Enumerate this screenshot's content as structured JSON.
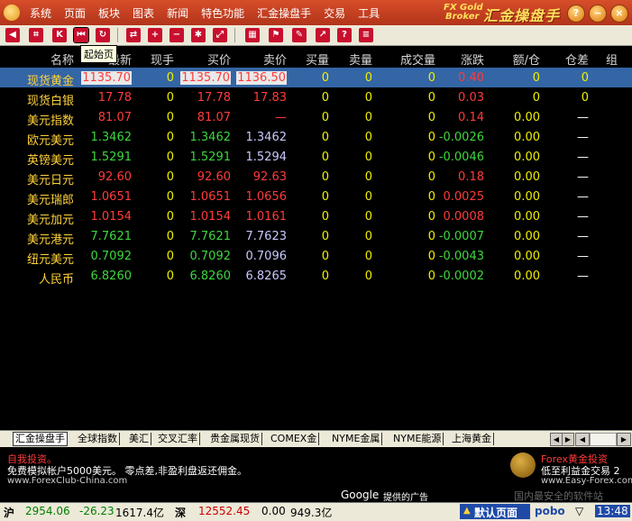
{
  "menu": [
    "系统",
    "页面",
    "板块",
    "图表",
    "新闻",
    "特色功能",
    "汇金操盘手",
    "交易",
    "工具"
  ],
  "brand": {
    "line1": "FX Gold",
    "line2": "Broker",
    "name": "汇金操盘手"
  },
  "window": {
    "help": "?",
    "min": "−",
    "max": "□",
    "close": "×"
  },
  "toolbar": {
    "tooltip": "起始页"
  },
  "columns": [
    "名称",
    "最新",
    "现手",
    "买价",
    "卖价",
    "买量",
    "卖量",
    "成交量",
    "涨跌",
    "额/仓",
    "仓差",
    "组"
  ],
  "rows": [
    {
      "name": "现货黄金",
      "last": "1135.70",
      "hand": "0",
      "bid": "1135.70",
      "ask": "1136.50",
      "bidv": "0",
      "askv": "0",
      "vol": "0",
      "chg": "0.40",
      "amt": "0",
      "diff": "0"
    },
    {
      "name": "现货白银",
      "last": "17.78",
      "hand": "0",
      "bid": "17.78",
      "ask": "17.83",
      "bidv": "0",
      "askv": "0",
      "vol": "0",
      "chg": "0.03",
      "amt": "0",
      "diff": "0"
    },
    {
      "name": "美元指数",
      "last": "81.07",
      "hand": "0",
      "bid": "81.07",
      "ask": "—",
      "bidv": "0",
      "askv": "0",
      "vol": "0",
      "chg": "0.14",
      "amt": "0.00",
      "diff": "—"
    },
    {
      "name": "欧元美元",
      "last": "1.3462",
      "hand": "0",
      "bid": "1.3462",
      "ask": "1.3462",
      "bidv": "0",
      "askv": "0",
      "vol": "0",
      "chg": "-0.0026",
      "amt": "0.00",
      "diff": "—"
    },
    {
      "name": "英镑美元",
      "last": "1.5291",
      "hand": "0",
      "bid": "1.5291",
      "ask": "1.5294",
      "bidv": "0",
      "askv": "0",
      "vol": "0",
      "chg": "-0.0046",
      "amt": "0.00",
      "diff": "—"
    },
    {
      "name": "美元日元",
      "last": "92.60",
      "hand": "0",
      "bid": "92.60",
      "ask": "92.63",
      "bidv": "0",
      "askv": "0",
      "vol": "0",
      "chg": "0.18",
      "amt": "0.00",
      "diff": "—"
    },
    {
      "name": "美元瑞郎",
      "last": "1.0651",
      "hand": "0",
      "bid": "1.0651",
      "ask": "1.0656",
      "bidv": "0",
      "askv": "0",
      "vol": "0",
      "chg": "0.0025",
      "amt": "0.00",
      "diff": "—"
    },
    {
      "name": "美元加元",
      "last": "1.0154",
      "hand": "0",
      "bid": "1.0154",
      "ask": "1.0161",
      "bidv": "0",
      "askv": "0",
      "vol": "0",
      "chg": "0.0008",
      "amt": "0.00",
      "diff": "—"
    },
    {
      "name": "美元港元",
      "last": "7.7621",
      "hand": "0",
      "bid": "7.7621",
      "ask": "7.7623",
      "bidv": "0",
      "askv": "0",
      "vol": "0",
      "chg": "-0.0007",
      "amt": "0.00",
      "diff": "—"
    },
    {
      "name": "纽元美元",
      "last": "0.7092",
      "hand": "0",
      "bid": "0.7092",
      "ask": "0.7096",
      "bidv": "0",
      "askv": "0",
      "vol": "0",
      "chg": "-0.0043",
      "amt": "0.00",
      "diff": "—"
    },
    {
      "name": "人民币",
      "last": "6.8260",
      "hand": "0",
      "bid": "6.8260",
      "ask": "6.8265",
      "bidv": "0",
      "askv": "0",
      "vol": "0",
      "chg": "-0.0002",
      "amt": "0.00",
      "diff": "—"
    }
  ],
  "tabs": [
    "汇金操盘手",
    "全球指数",
    "美汇",
    "交叉汇率",
    "贵金属现货",
    "COMEX金",
    "NYME金属",
    "NYME能源",
    "上海黄金"
  ],
  "ad": {
    "title": "自我投资。",
    "text": "免费模拟帐户5000美元。 零点差,非盈利盘返还佣金。",
    "url": "www.ForexClub-China.com",
    "google": "Google",
    "google_suffix": "提供的广告",
    "right_title": "Forex黄金投资",
    "right_text": "低至利益金交易 2",
    "right_url": "www.Easy-Forex.com",
    "watermark": "国内最安全的软件站"
  },
  "status": {
    "sh_label": "沪",
    "sh_index": "2954.06",
    "sh_chg": "-26.23",
    "sh_amt": "1617.4亿",
    "sz_label": "深",
    "sz_index": "12552.45",
    "sz_chg": "0.00",
    "sz_amt": "949.3亿",
    "default_page": "默认页面",
    "pobo": "pobo",
    "time": "13:48"
  },
  "colors": {
    "up": "#ff3b3b",
    "down": "#3ed63e",
    "neutral": "#f0f000",
    "selected": "#3465a4",
    "name": "#ffd23a"
  }
}
